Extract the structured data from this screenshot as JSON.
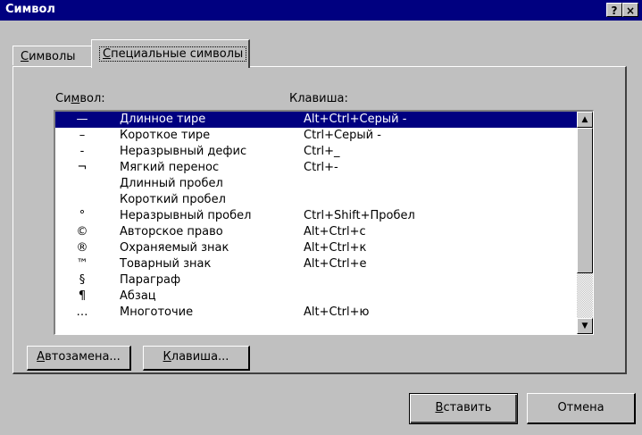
{
  "window": {
    "title": "Символ",
    "help_glyph": "?",
    "close_glyph": "×"
  },
  "tabs": [
    {
      "label_u": "С",
      "label_rest": "имволы",
      "active": false
    },
    {
      "label_u": "С",
      "label_rest": "пециальные символы",
      "active": true
    }
  ],
  "columns": {
    "symbol_pre": "Си",
    "symbol_u": "м",
    "symbol_post": "вол:",
    "shortcut": "Клавиша:"
  },
  "rows": [
    {
      "sym": "—",
      "name": "Длинное тире",
      "key": "Alt+Ctrl+Серый -",
      "selected": true
    },
    {
      "sym": "–",
      "name": "Короткое тире",
      "key": "Ctrl+Серый -"
    },
    {
      "sym": "-",
      "name": "Неразрывный дефис",
      "key": "Ctrl+_"
    },
    {
      "sym": "¬",
      "name": "Мягкий перенос",
      "key": "Ctrl+-"
    },
    {
      "sym": "",
      "name": "Длинный пробел",
      "key": ""
    },
    {
      "sym": "",
      "name": "Короткий пробел",
      "key": ""
    },
    {
      "sym": "°",
      "name": "Неразрывный пробел",
      "key": "Ctrl+Shift+Пробел"
    },
    {
      "sym": "©",
      "name": "Авторское право",
      "key": "Alt+Ctrl+с"
    },
    {
      "sym": "®",
      "name": "Охраняемый знак",
      "key": "Alt+Ctrl+к"
    },
    {
      "sym": "™",
      "name": "Товарный знак",
      "key": "Alt+Ctrl+е"
    },
    {
      "sym": "§",
      "name": "Параграф",
      "key": ""
    },
    {
      "sym": "¶",
      "name": "Абзац",
      "key": ""
    },
    {
      "sym": "…",
      "name": "Многоточие",
      "key": "Alt+Ctrl+ю"
    }
  ],
  "scrollbar": {
    "up_icon": "▲",
    "down_icon": "▼"
  },
  "buttons": {
    "autocorrect_u": "А",
    "autocorrect_rest": "втозамена...",
    "shortcut_u": "К",
    "shortcut_rest": "лавиша...",
    "insert_u": "В",
    "insert_rest": "ставить",
    "cancel": "Отмена"
  }
}
